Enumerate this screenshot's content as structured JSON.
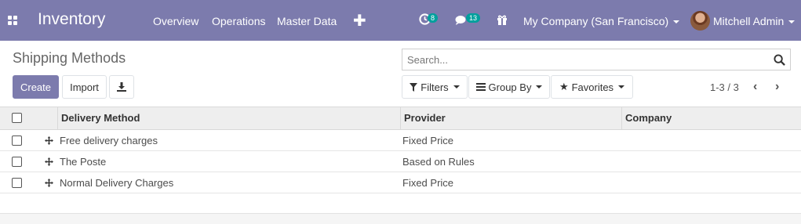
{
  "navbar": {
    "app_title": "Inventory",
    "menu": [
      "Overview",
      "Operations",
      "Master Data"
    ],
    "activity_count": "8",
    "message_count": "13",
    "company": "My Company (San Francisco)",
    "user": "Mitchell Admin",
    "color": "#7c7bad"
  },
  "control_panel": {
    "breadcrumb": "Shipping Methods",
    "search_placeholder": "Search...",
    "create_label": "Create",
    "import_label": "Import",
    "filters_label": "Filters",
    "group_by_label": "Group By",
    "favorites_label": "Favorites",
    "pager": "1-3 / 3"
  },
  "table": {
    "columns": [
      "Delivery Method",
      "Provider",
      "Company"
    ],
    "rows": [
      {
        "method": "Free delivery charges",
        "provider": "Fixed Price",
        "company": ""
      },
      {
        "method": "The Poste",
        "provider": "Based on Rules",
        "company": ""
      },
      {
        "method": "Normal Delivery Charges",
        "provider": "Fixed Price",
        "company": ""
      }
    ]
  }
}
